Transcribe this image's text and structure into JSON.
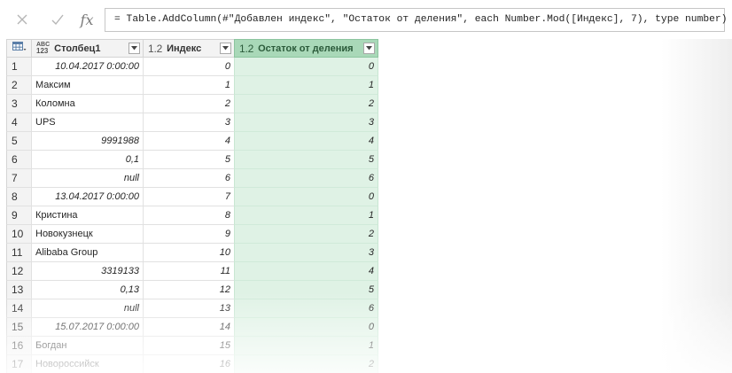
{
  "formula": "= Table.AddColumn(#\"Добавлен индекс\", \"Остаток от деления\", each Number.Mod([Индекс], 7), type number)",
  "columns": [
    {
      "type": "ABC\n123",
      "label": "Столбец1"
    },
    {
      "type": "1.2",
      "label": "Индекс"
    },
    {
      "type": "1.2",
      "label": "Остаток от деления"
    }
  ],
  "icons": {
    "cancel": "x-icon",
    "confirm": "check-icon",
    "fx": "fx",
    "table": "table-icon",
    "dropdown": "chevron-down-icon"
  },
  "rows": [
    {
      "n": "1",
      "c1": "10.04.2017 0:00:00",
      "c1num": true,
      "c2": "0",
      "c3": "0"
    },
    {
      "n": "2",
      "c1": "Максим",
      "c1num": false,
      "c2": "1",
      "c3": "1"
    },
    {
      "n": "3",
      "c1": "Коломна",
      "c1num": false,
      "c2": "2",
      "c3": "2"
    },
    {
      "n": "4",
      "c1": "UPS",
      "c1num": false,
      "c2": "3",
      "c3": "3"
    },
    {
      "n": "5",
      "c1": "9991988",
      "c1num": true,
      "c2": "4",
      "c3": "4"
    },
    {
      "n": "6",
      "c1": "0,1",
      "c1num": true,
      "c2": "5",
      "c3": "5"
    },
    {
      "n": "7",
      "c1": "null",
      "c1num": true,
      "c2": "6",
      "c3": "6"
    },
    {
      "n": "8",
      "c1": "13.04.2017 0:00:00",
      "c1num": true,
      "c2": "7",
      "c3": "0"
    },
    {
      "n": "9",
      "c1": "Кристина",
      "c1num": false,
      "c2": "8",
      "c3": "1"
    },
    {
      "n": "10",
      "c1": "Новокузнецк",
      "c1num": false,
      "c2": "9",
      "c3": "2"
    },
    {
      "n": "11",
      "c1": "Alibaba Group",
      "c1num": false,
      "c2": "10",
      "c3": "3"
    },
    {
      "n": "12",
      "c1": "3319133",
      "c1num": true,
      "c2": "11",
      "c3": "4"
    },
    {
      "n": "13",
      "c1": "0,13",
      "c1num": true,
      "c2": "12",
      "c3": "5"
    },
    {
      "n": "14",
      "c1": "null",
      "c1num": true,
      "c2": "13",
      "c3": "6"
    },
    {
      "n": "15",
      "c1": "15.07.2017 0:00:00",
      "c1num": true,
      "c2": "14",
      "c3": "0"
    },
    {
      "n": "16",
      "c1": "Богдан",
      "c1num": false,
      "c2": "15",
      "c3": "1"
    },
    {
      "n": "17",
      "c1": "Новороссийск",
      "c1num": false,
      "c2": "16",
      "c3": "2"
    }
  ]
}
